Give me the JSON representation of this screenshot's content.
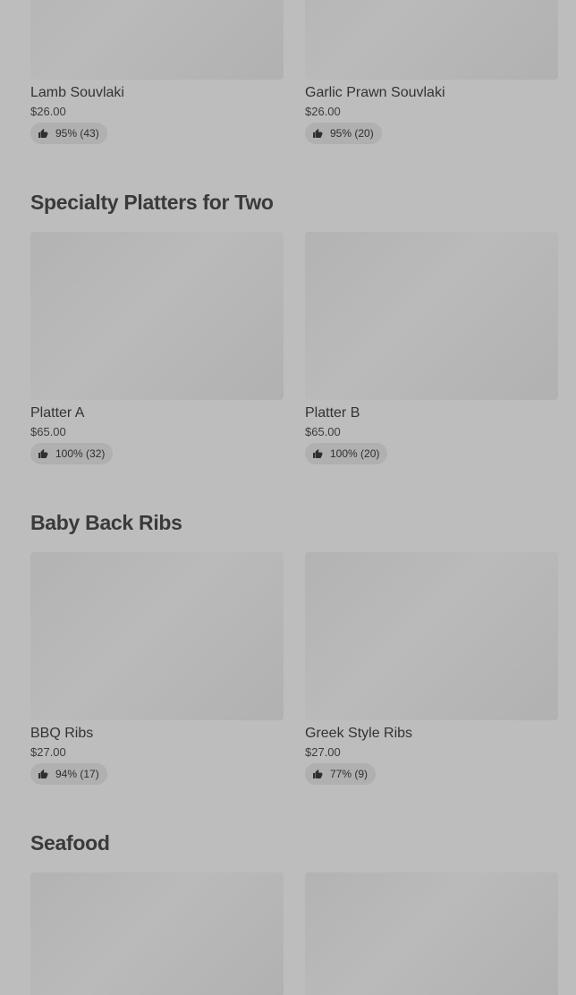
{
  "sections": [
    {
      "title": "",
      "items": [
        {
          "name": "Lamb Souvlaki",
          "price": "$26.00",
          "rating": "95% (43)"
        },
        {
          "name": "Garlic Prawn Souvlaki",
          "price": "$26.00",
          "rating": "95% (20)"
        }
      ]
    },
    {
      "title": "Specialty Platters for Two",
      "items": [
        {
          "name": "Platter A",
          "price": "$65.00",
          "rating": "100% (32)"
        },
        {
          "name": "Platter B",
          "price": "$65.00",
          "rating": "100% (20)"
        }
      ]
    },
    {
      "title": "Baby Back Ribs",
      "items": [
        {
          "name": "BBQ Ribs",
          "price": "$27.00",
          "rating": "94% (17)"
        },
        {
          "name": "Greek Style Ribs",
          "price": "$27.00",
          "rating": "77% (9)"
        }
      ]
    },
    {
      "title": "Seafood",
      "items": [
        {
          "name": "",
          "price": "",
          "rating": ""
        },
        {
          "name": "",
          "price": "",
          "rating": ""
        }
      ]
    }
  ],
  "icons": {
    "rating": "thumbs-up-icon"
  }
}
